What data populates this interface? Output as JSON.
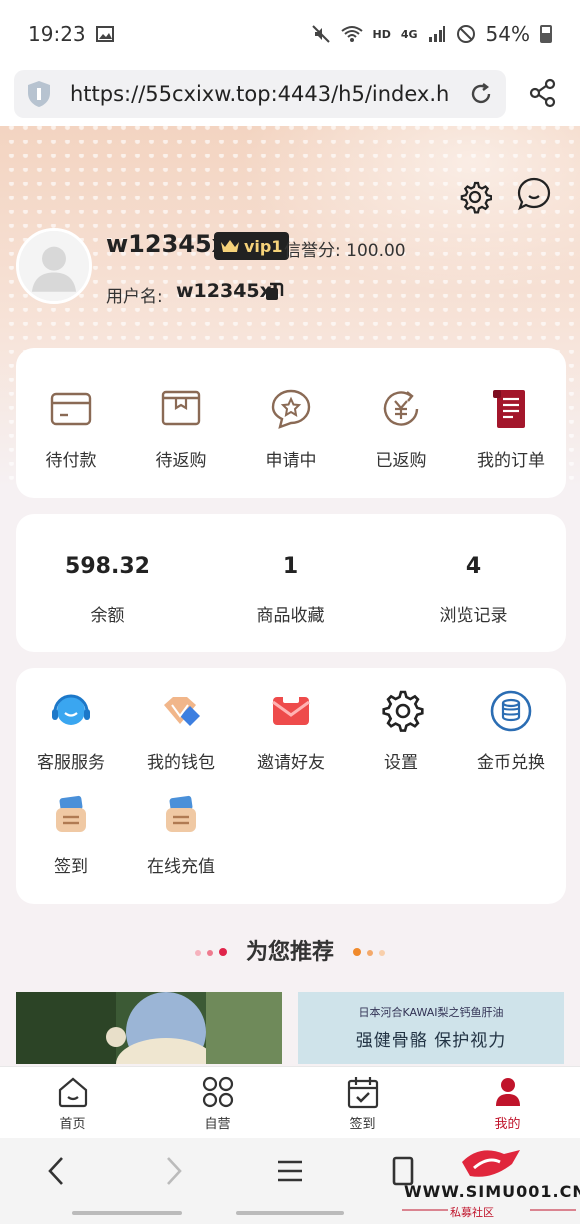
{
  "status_bar": {
    "time": "19:23",
    "net": "HD",
    "net2": "4G",
    "battery": "54%"
  },
  "browser": {
    "url": "https://55cxixw.top:4443/h5/index.ht"
  },
  "profile": {
    "username": "w12345xl",
    "vip": "vip1",
    "credit": "信誉分: 100.00",
    "userid_label": "用户名:",
    "userid": "w12345xl"
  },
  "orders": [
    {
      "label": "待付款",
      "icon": "wallet-card-icon"
    },
    {
      "label": "待返购",
      "icon": "pending-box-icon"
    },
    {
      "label": "申请中",
      "icon": "star-chat-icon"
    },
    {
      "label": "已返购",
      "icon": "yen-refresh-icon"
    },
    {
      "label": "我的订单",
      "icon": "order-scroll-icon"
    }
  ],
  "stats": [
    {
      "value": "598.32",
      "caption": "余额"
    },
    {
      "value": "1",
      "caption": "商品收藏"
    },
    {
      "value": "4",
      "caption": "浏览记录"
    }
  ],
  "tools": [
    {
      "label": "客服服务",
      "icon": "headset-icon"
    },
    {
      "label": "我的钱包",
      "icon": "wallet-diamond-icon"
    },
    {
      "label": "邀请好友",
      "icon": "envelope-icon"
    },
    {
      "label": "设置",
      "icon": "gear-icon"
    },
    {
      "label": "金币兑换",
      "icon": "coin-stack-icon"
    },
    {
      "label": "签到",
      "icon": "checkin-card-icon"
    },
    {
      "label": "在线充值",
      "icon": "recharge-card-icon"
    }
  ],
  "recommend": {
    "title": "为您推荐",
    "product2_small": "日本河合KAWAI梨之钙鱼肝油",
    "product2_big": "强健骨骼 保护视力"
  },
  "tabbar": [
    {
      "label": "首页",
      "icon": "home-icon"
    },
    {
      "label": "自营",
      "icon": "grid-icon"
    },
    {
      "label": "签到",
      "icon": "calendar-check-icon"
    },
    {
      "label": "我的",
      "icon": "user-icon"
    }
  ],
  "watermark": {
    "text": "WWW.SIMU001.CN",
    "sub": "私募社区"
  },
  "colors": {
    "accent": "#c0142b",
    "brown": "#8a6a55",
    "header": "#f3d4c1"
  }
}
